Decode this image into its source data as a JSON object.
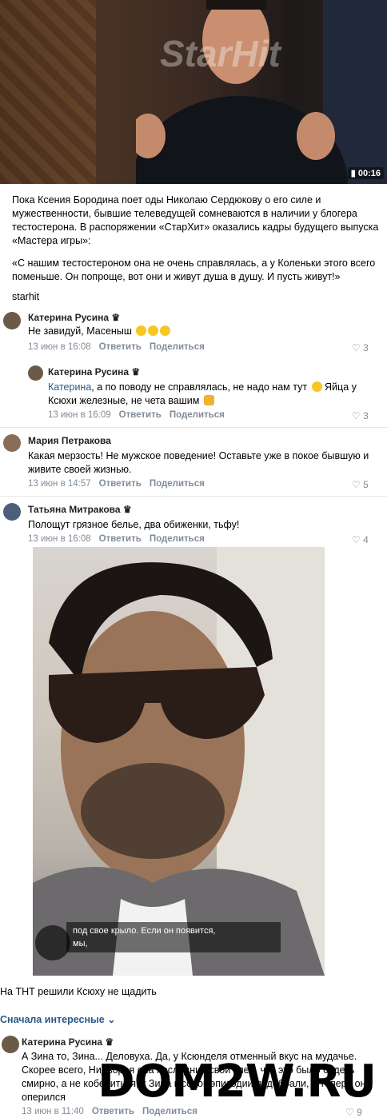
{
  "video": {
    "duration": "00:16",
    "watermark": "StarHit"
  },
  "post": {
    "text1": "Пока Ксения Бородина поет оды Николаю Сердюкову о его силе и мужественности, бывшие телеведущей сомневаются в наличии у блогера тестостерона. В распоряжении «СтарХит» оказались кадры будущего выпуска «Мастера игры»:",
    "quote": "«С нашим тестостероном она не очень справлялась, а у Коленьки этого всего поменьше. Он попроще, вот они и живут душа в душу. И пусть живут!»",
    "source": "starhit"
  },
  "comments": [
    {
      "name": "Катерина Русина",
      "text": "Не завидуй, Масеныш",
      "date": "13 июн в 16:08",
      "reply": "Ответить",
      "share": "Поделиться",
      "likes": "3"
    },
    {
      "name": "Катерина Русина",
      "mention": "Катерина",
      "text": ", а по поводу не справлялась, не надо нам тут",
      "text2": " Яйца у Ксюхи железные, не чета вашим",
      "date": "13 июн в 16:09",
      "reply": "Ответить",
      "share": "Поделиться",
      "likes": "3"
    },
    {
      "name": "Мария Петракова",
      "text": "Какая мерзость! Не мужское поведение! Оставьте уже в покое бывшую и живите своей жизнью.",
      "date": "13 июн в 14:57",
      "reply": "Ответить",
      "share": "Поделиться",
      "likes": "5"
    },
    {
      "name": "Татьяна Митракова",
      "text": "Полощут грязное белье, два обиженки, тьфу!",
      "date": "13 июн в 16:08",
      "reply": "Ответить",
      "share": "Поделиться",
      "likes": "4"
    }
  ],
  "photo_subtitle": "под свое крыло. Если он появится,\nмы,",
  "post2": {
    "text": "На ТНТ решили Ксюху не щадить",
    "sort": "Сначала интересные"
  },
  "comment5": {
    "name": "Катерина Русина",
    "text": "А Зина то, Зина... Деловуха. Да, у Ксюнделя отменный вкус на мудачье. Скорее всего, Нидворая она последний свой клей, что это было сидеть смирно, а не кобениться, к Зина к сорок эпизодии подобрали, а теперь он оперился",
    "date": "13 июн в 11:40",
    "reply": "Ответить",
    "share": "Поделиться",
    "likes": "9"
  },
  "watermark_site": "DOM2W.RU"
}
